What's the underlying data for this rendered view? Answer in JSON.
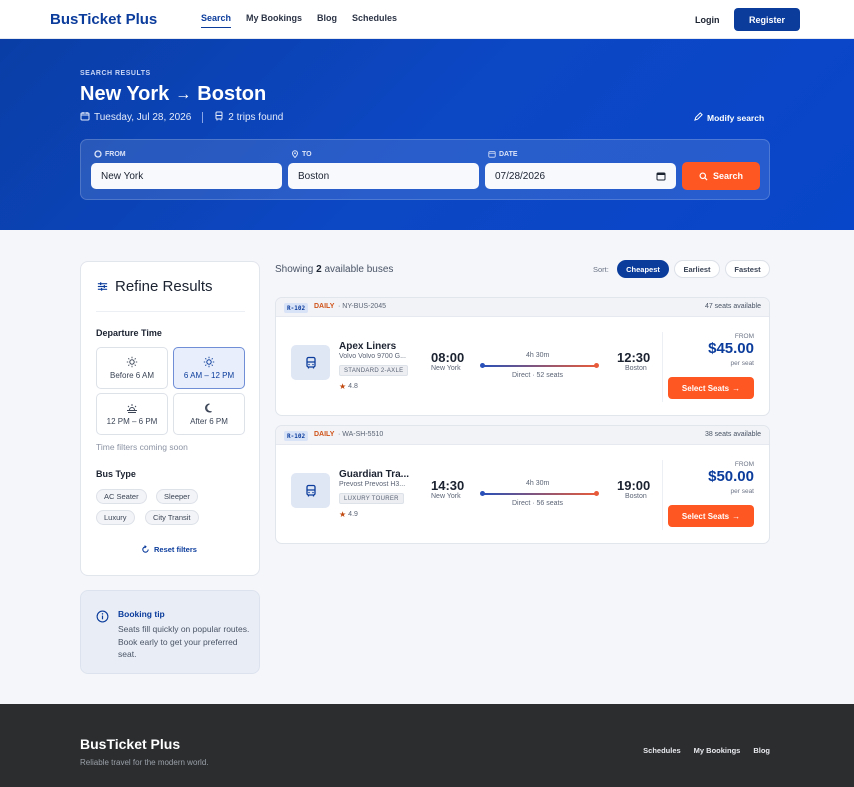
{
  "nav": {
    "brand": "BusTicket Plus",
    "links": [
      "Search",
      "My Bookings",
      "Blog",
      "Schedules"
    ],
    "login": "Login",
    "register": "Register"
  },
  "hero": {
    "eyebrow": "SEARCH RESULTS",
    "from_city": "New York",
    "to_city": "Boston",
    "date_text": "Tuesday, Jul 28, 2026",
    "trips_text": "2 trips found",
    "modify": "Modify search"
  },
  "search": {
    "from_label": "FROM",
    "from_value": "New York",
    "to_label": "TO",
    "to_value": "Boston",
    "date_label": "DATE",
    "date_value": "07/28/2026",
    "button": "Search"
  },
  "filters": {
    "title": "Refine Results",
    "departure_heading": "Departure Time",
    "times": [
      {
        "label": "Before 6 AM",
        "icon": "sunrise-icon",
        "active": false
      },
      {
        "label": "6 AM – 12 PM",
        "icon": "sun-icon",
        "active": true
      },
      {
        "label": "12 PM – 6 PM",
        "icon": "sunset-icon",
        "active": false
      },
      {
        "label": "After 6 PM",
        "icon": "moon-icon",
        "active": false
      }
    ],
    "time_note": "Time filters coming soon",
    "bus_type_heading": "Bus Type",
    "bus_types": [
      "AC Seater",
      "Sleeper",
      "Luxury",
      "City Transit"
    ],
    "reset": "Reset filters"
  },
  "tip": {
    "title": "Booking tip",
    "body": "Seats fill quickly on popular routes. Book early to get your preferred seat."
  },
  "results": {
    "showing_prefix": "Showing",
    "count": "2",
    "showing_suffix": "available buses",
    "sort_label": "Sort:",
    "sort_options": [
      "Cheapest",
      "Earliest",
      "Fastest"
    ],
    "active_sort": "Cheapest"
  },
  "buses": [
    {
      "route_code": "R-102",
      "frequency": "DAILY",
      "bus_id": "· NY-BUS-2045",
      "seats_available": "47 seats available",
      "operator": "Apex Liners",
      "model": "Volvo Volvo 9700 G...",
      "tag": "STANDARD 2-AXLE",
      "rating": "4.8",
      "depart_time": "08:00",
      "depart_city": "New York",
      "duration": "4h 30m",
      "stops": "Direct · 52 seats",
      "arrive_time": "12:30",
      "arrive_city": "Boston",
      "from_label": "FROM",
      "price": "$45.00",
      "per_seat": "per seat",
      "cta": "Select Seats"
    },
    {
      "route_code": "R-102",
      "frequency": "DAILY",
      "bus_id": "· WA-SH-5510",
      "seats_available": "38 seats available",
      "operator": "Guardian Tra...",
      "model": "Prevost Prevost H3...",
      "tag": "LUXURY TOURER",
      "rating": "4.9",
      "depart_time": "14:30",
      "depart_city": "New York",
      "duration": "4h 30m",
      "stops": "Direct · 56 seats",
      "arrive_time": "19:00",
      "arrive_city": "Boston",
      "from_label": "FROM",
      "price": "$50.00",
      "per_seat": "per seat",
      "cta": "Select Seats"
    }
  ],
  "footer": {
    "brand": "BusTicket Plus",
    "tagline": "Reliable travel for the modern world.",
    "links": [
      "Schedules",
      "My Bookings",
      "Blog"
    ]
  },
  "colors": {
    "primary": "#0b3c9c",
    "accent": "#ff5722",
    "hero": "#0c47c4",
    "footer": "#2b2d2f"
  }
}
